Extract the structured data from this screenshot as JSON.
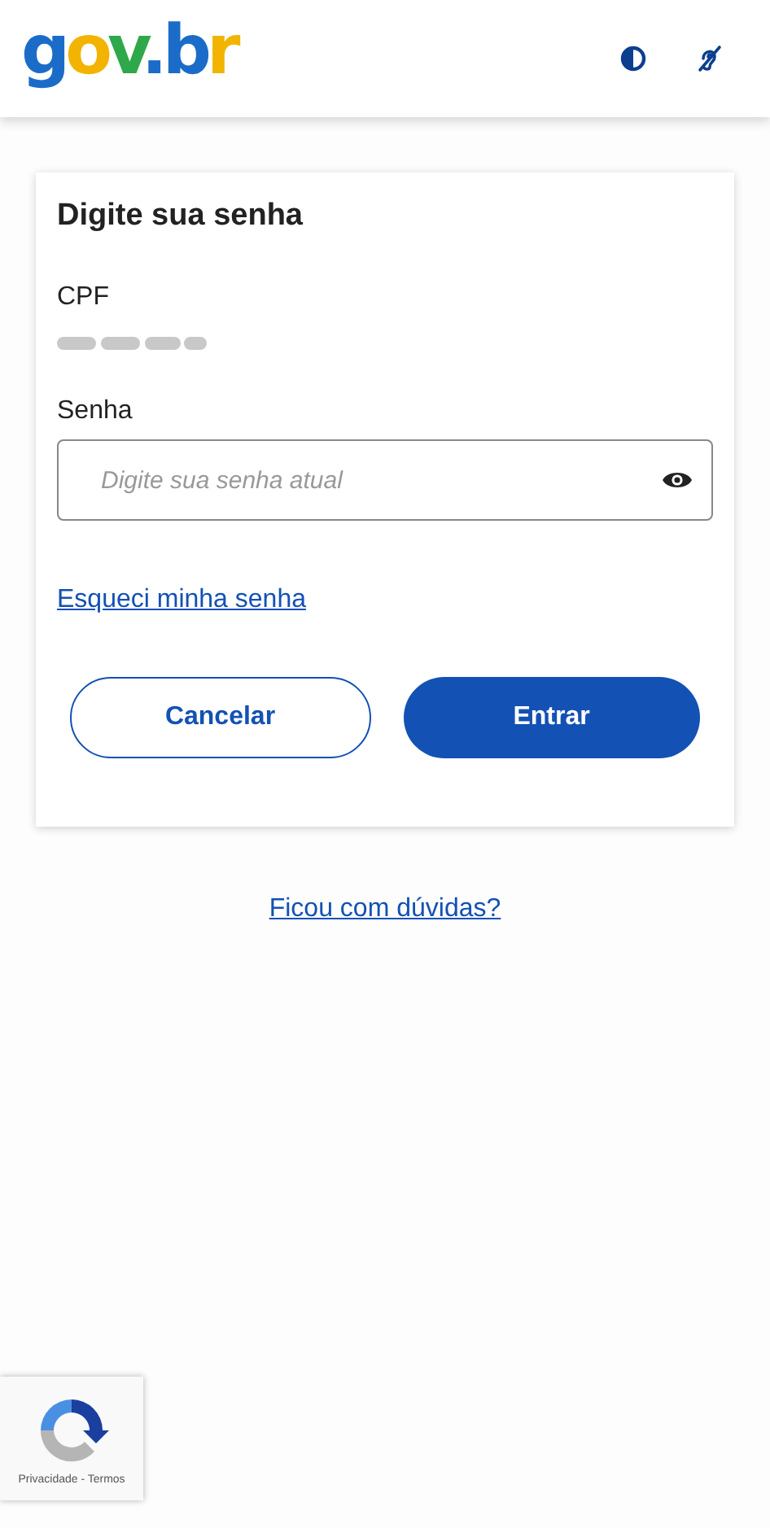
{
  "header": {
    "logo": "gov.br"
  },
  "card": {
    "title": "Digite sua senha",
    "cpf_label": "CPF",
    "password_label": "Senha",
    "password_placeholder": "Digite sua senha atual",
    "forgot_link": "Esqueci minha senha",
    "buttons": [
      {
        "label": "Cancelar",
        "kind": "secondary"
      },
      {
        "label": "Entrar",
        "kind": "primary"
      }
    ]
  },
  "help_link": "Ficou com dúvidas?",
  "recaptcha": {
    "text": "Privacidade - Termos"
  }
}
